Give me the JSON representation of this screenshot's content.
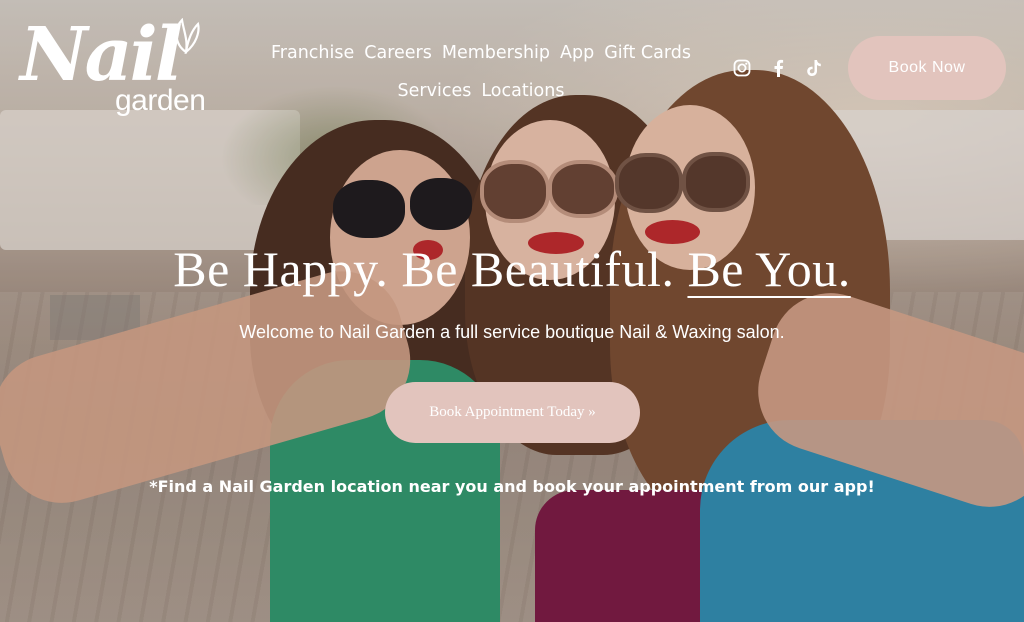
{
  "brand": {
    "logo_main": "Nail",
    "logo_sub": "garden"
  },
  "nav": {
    "items": [
      "Franchise",
      "Careers",
      "Membership",
      "App",
      "Gift Cards",
      "Services",
      "Locations"
    ]
  },
  "social": {
    "icons": [
      "instagram-icon",
      "facebook-icon",
      "tiktok-icon"
    ]
  },
  "header": {
    "book_now": "Book Now"
  },
  "hero": {
    "headline_part1": "Be Happy. Be Beautiful. ",
    "headline_part2": "Be You.",
    "subheading": "Welcome to Nail Garden a full service boutique Nail & Waxing salon.",
    "cta": "Book Appointment Today »",
    "note": "*Find a Nail Garden location near you and book your appointment from our app!"
  },
  "colors": {
    "button_bg": "#e2c4bd",
    "text": "#ffffff"
  }
}
